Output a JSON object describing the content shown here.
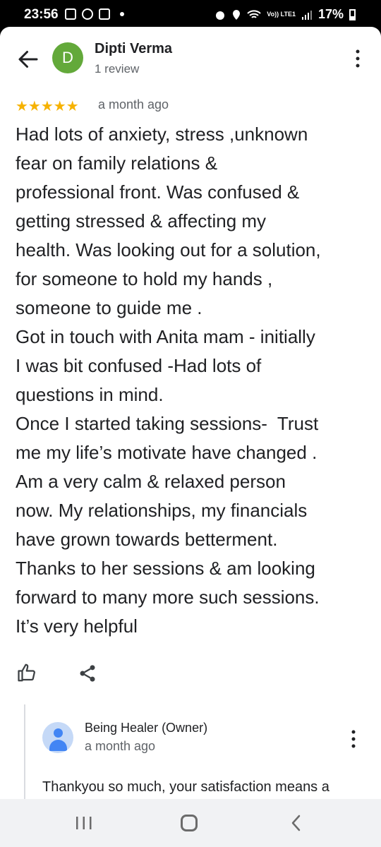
{
  "status_bar": {
    "time": "23:56",
    "network": "Vo)) LTE1",
    "battery": "17%"
  },
  "reviewer": {
    "avatar_letter": "D",
    "name": "Dipti Verma",
    "review_count": "1 review",
    "avatar_color": "#63a93a"
  },
  "review": {
    "rating": 5,
    "stars_text": "★★★★★",
    "date": "a month ago",
    "text": "Had lots of anxiety, stress ,unknown\nfear on family relations &\nprofessional front. Was confused &\ngetting stressed & affecting my\nhealth. Was looking out for a solution,\nfor someone to hold my hands ,\nsomeone to guide me .\nGot in touch with Anita mam - initially\nI was bit confused -Had lots of\nquestions in mind.\nOnce I started taking sessions-  Trust\nme my life’s motivate have changed .\nAm a very calm & relaxed person\nnow. My relationships, my financials\nhave grown towards betterment.\nThanks to her sessions & am looking\nforward to many more such sessions.\nIt’s very helpful"
  },
  "owner_reply": {
    "name": "Being Healer (Owner)",
    "date": "a month ago",
    "text": "Thankyou so much, your satisfaction means a"
  },
  "icons": {
    "back": "arrow-back-icon",
    "menu": "more-vert-icon",
    "like": "thumb-up-icon",
    "share": "share-icon",
    "nav_recent": "recent-apps-icon",
    "nav_home": "home-icon",
    "nav_back": "chevron-left-icon"
  },
  "colors": {
    "star": "#f6b200",
    "text": "#202124",
    "secondary_text": "#5f6368"
  }
}
